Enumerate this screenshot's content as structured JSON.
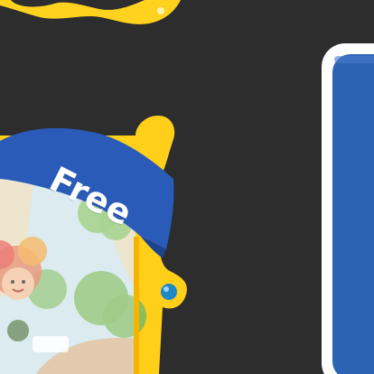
{
  "game_card": {
    "badge_label": "Free",
    "colors": {
      "background": "#2d2d2d",
      "frame_yellow": "#ffcf1a",
      "ribbon_blue": "#2a5bb8",
      "panel_blue": "#2d63b3"
    }
  },
  "icons": {
    "top_decoration": "yellow-cloud-icon",
    "frame_button": "blue-dot-icon"
  }
}
